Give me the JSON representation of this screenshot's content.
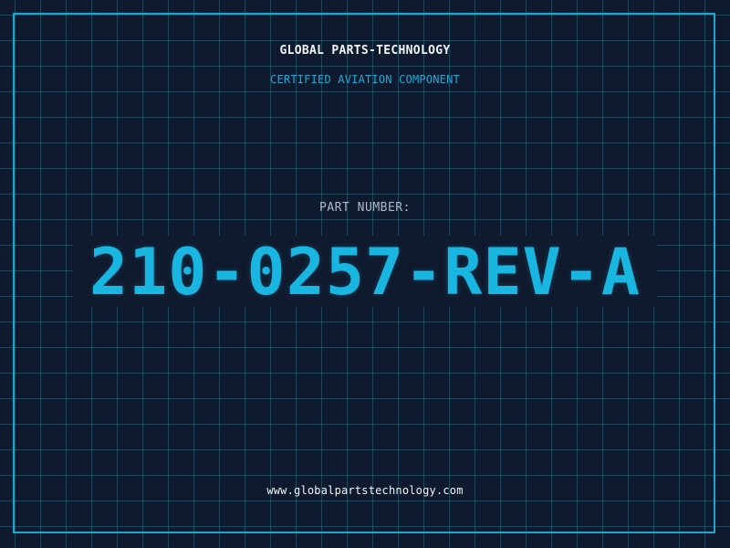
{
  "label": {
    "company": "GLOBAL PARTS-TECHNOLOGY",
    "tagline": "CERTIFIED AVIATION COMPONENT",
    "part_number_label": "PART NUMBER:",
    "part_number": "210-0257-REV-A",
    "website": "www.globalpartstechnology.com"
  },
  "colors": {
    "background": "#101a2e",
    "grid": "#28829a",
    "frame": "#1ea6cf",
    "accent": "#19b6e2",
    "text_primary": "#f2f5f8",
    "text_muted": "#aeb8c6"
  }
}
